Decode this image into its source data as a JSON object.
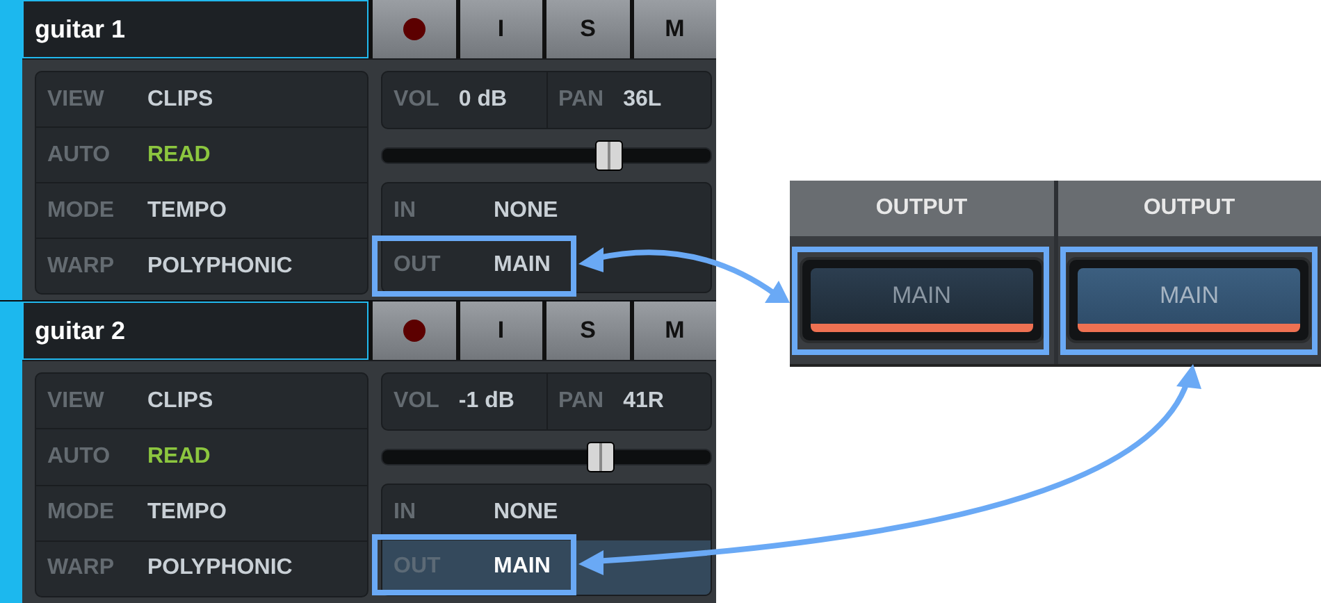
{
  "tracks": [
    {
      "name": "guitar 1",
      "buttons": [
        "I",
        "S",
        "M"
      ],
      "settings": [
        {
          "label": "VIEW",
          "value": "CLIPS",
          "kind": "plain"
        },
        {
          "label": "AUTO",
          "value": "READ",
          "kind": "active"
        },
        {
          "label": "MODE",
          "value": "TEMPO",
          "kind": "plain"
        },
        {
          "label": "WARP",
          "value": "POLYPHONIC",
          "kind": "plain"
        }
      ],
      "volume": {
        "label": "VOL",
        "value": "0 dB"
      },
      "pan": {
        "label": "PAN",
        "value": "36L"
      },
      "fader": {
        "level": 0.69
      },
      "routing": [
        {
          "label": "IN",
          "value": "NONE",
          "selected": false
        },
        {
          "label": "OUT",
          "value": "MAIN",
          "selected": false
        }
      ]
    },
    {
      "name": "guitar 2",
      "buttons": [
        "I",
        "S",
        "M"
      ],
      "settings": [
        {
          "label": "VIEW",
          "value": "CLIPS",
          "kind": "plain"
        },
        {
          "label": "AUTO",
          "value": "READ",
          "kind": "active"
        },
        {
          "label": "MODE",
          "value": "TEMPO",
          "kind": "plain"
        },
        {
          "label": "WARP",
          "value": "POLYPHONIC",
          "kind": "plain"
        }
      ],
      "volume": {
        "label": "VOL",
        "value": "-1 dB"
      },
      "pan": {
        "label": "PAN",
        "value": "41R"
      },
      "fader": {
        "level": 0.665
      },
      "routing": [
        {
          "label": "IN",
          "value": "NONE",
          "selected": false
        },
        {
          "label": "OUT",
          "value": "MAIN",
          "selected": true
        }
      ]
    }
  ],
  "output_channels": [
    {
      "header": "OUTPUT",
      "button": "MAIN",
      "selected": false
    },
    {
      "header": "OUTPUT",
      "button": "MAIN",
      "selected": true
    }
  ]
}
